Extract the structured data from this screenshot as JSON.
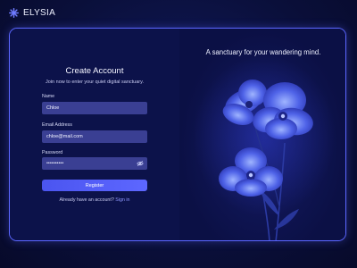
{
  "brand": {
    "name": "ELYSIA",
    "logo_icon": "star-burst-icon"
  },
  "form": {
    "title": "Create Account",
    "subtitle": "Join now to enter your quiet digital sanctuary.",
    "name_label": "Name",
    "name_value": "Chloe",
    "email_label": "Email Address",
    "email_value": "chloe@mail.com",
    "password_label": "Password",
    "password_value": "••••••••••",
    "password_toggle_icon": "eye-slash-icon",
    "register_label": "Register",
    "signin_prompt": "Already have an account?",
    "signin_link": "Sign in"
  },
  "hero": {
    "tagline": "A sanctuary for your wandering mind.",
    "image": "blue-poppy-flowers"
  },
  "colors": {
    "accent": "#5b66ff",
    "background": "#0a0f3a",
    "input_bg": "#3a3f93",
    "link": "#8e97ff"
  }
}
